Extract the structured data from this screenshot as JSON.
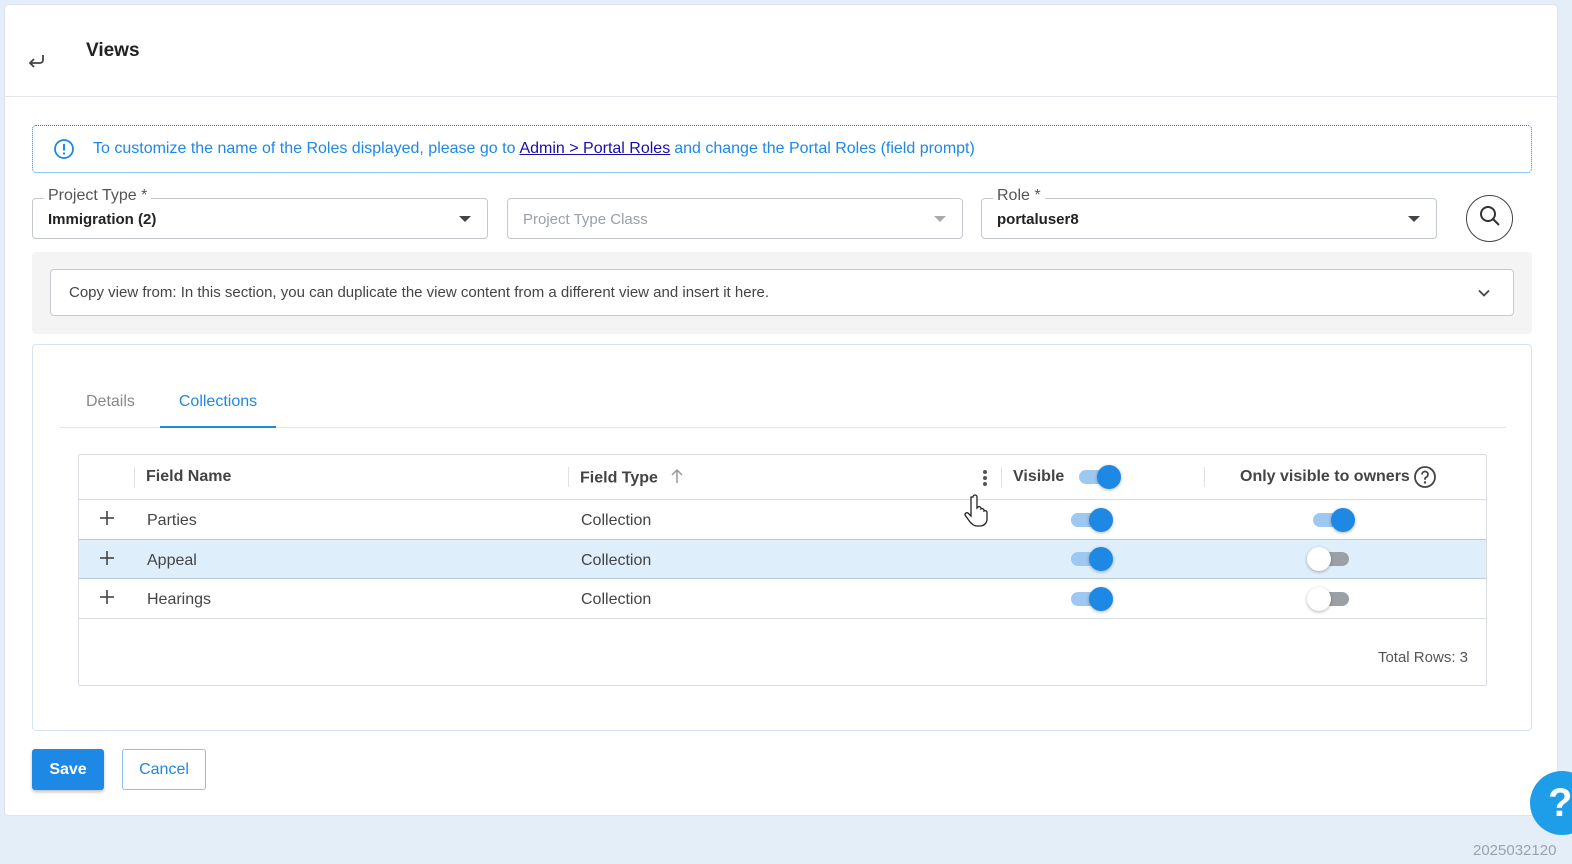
{
  "header": {
    "title": "Views",
    "back_icon": "return-arrow-icon"
  },
  "info": {
    "prefix": "To customize the name of the Roles displayed, please go to",
    "link": "Admin > Portal Roles",
    "suffix": "and change the Portal Roles (field prompt)",
    "icon": "info-circle-icon",
    "color": "#1e88e5"
  },
  "filters": {
    "project_type": {
      "label": "Project Type *",
      "value": "Immigration (2)"
    },
    "project_type_class": {
      "placeholder": "Project Type Class"
    },
    "role": {
      "label": "Role *",
      "value": "portaluser8"
    },
    "search_icon": "search-icon"
  },
  "copy_view": {
    "text": "Copy view from: In this section, you can duplicate the view content from a different view and insert it here."
  },
  "tabs": [
    {
      "label": "Details",
      "active": false
    },
    {
      "label": "Collections",
      "active": true
    }
  ],
  "grid": {
    "columns": {
      "field_name": "Field Name",
      "field_type": "Field Type",
      "visible": "Visible",
      "owners": "Only visible to owners"
    },
    "header_visible_toggle": true,
    "rows": [
      {
        "name": "Parties",
        "type": "Collection",
        "visible": true,
        "owners_only": true,
        "selected": false
      },
      {
        "name": "Appeal",
        "type": "Collection",
        "visible": true,
        "owners_only": false,
        "selected": true
      },
      {
        "name": "Hearings",
        "type": "Collection",
        "visible": true,
        "owners_only": false,
        "selected": false
      }
    ],
    "total_rows": "Total Rows: 3"
  },
  "actions": {
    "save": "Save",
    "cancel": "Cancel"
  },
  "help_fab": "?",
  "build_stamp": "2025032120",
  "accent_color": "#1e88e5"
}
